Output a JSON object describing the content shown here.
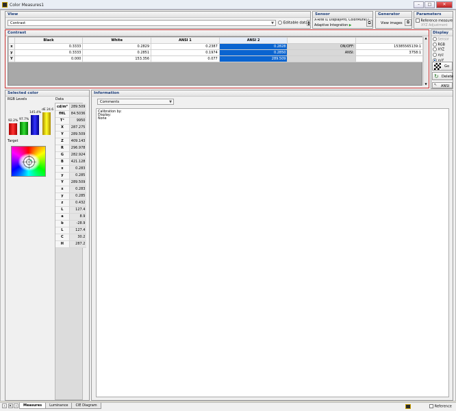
{
  "window": {
    "title": "Color Measures1",
    "min": "–",
    "max": "□",
    "close": "✕"
  },
  "view": {
    "title": "View",
    "selected": "Contrast",
    "editable_label": "Editable data"
  },
  "sensor": {
    "title": "Sensor",
    "device": "X-Rite i1 DisplayPro, ColorMunki Display",
    "mode": "Adaptive Integration"
  },
  "generator": {
    "title": "Generator",
    "button": "View images"
  },
  "parameters": {
    "title": "Parameters",
    "reference": "Reference measure",
    "adjust": "XYZ Adjustment"
  },
  "contrast": {
    "title": "Contrast",
    "columns": [
      "Black",
      "White",
      "ANSI 1",
      "ANSI 2"
    ],
    "rows": [
      {
        "h": "x",
        "cells": [
          "0.3333",
          "0.2829",
          "0.2387",
          "0.2828"
        ],
        "lbl": "ON/OFF:",
        "lval": "15385565139:1"
      },
      {
        "h": "y",
        "cells": [
          "0.3333",
          "0.2851",
          "0.1974",
          "0.2850"
        ],
        "lbl": "ANSI:",
        "lval": "3758:1"
      },
      {
        "h": "Y",
        "cells": [
          "0.000",
          "153.356",
          "0.077",
          "289.509"
        ],
        "lbl": "",
        "lval": ""
      }
    ]
  },
  "display": {
    "title": "Display",
    "options": [
      {
        "label": "Sensor",
        "on": false,
        "disabled": true
      },
      {
        "label": "RGB",
        "on": false,
        "disabled": false
      },
      {
        "label": "XYZ",
        "on": false,
        "disabled": false
      },
      {
        "label": "xyz",
        "on": false,
        "disabled": false
      },
      {
        "label": "xyY",
        "on": true,
        "disabled": false
      }
    ],
    "go": "Go",
    "delete": "Delete",
    "ansi": "ANSI"
  },
  "selected": {
    "title": "Selected color",
    "rgb_title": "RGB Levels",
    "data_title": "Data",
    "bars": {
      "r": "92.2%",
      "g": "97.7%",
      "b": "145.4%",
      "de": "dE 24.6"
    },
    "target": "Target",
    "rows": [
      [
        "cd/m²",
        "289.509"
      ],
      [
        "fHL",
        "84.5036"
      ],
      [
        "T°",
        "9950"
      ],
      [
        "X",
        "287.275"
      ],
      [
        "Y",
        "289.509"
      ],
      [
        "Z",
        "409.143"
      ],
      [
        "R",
        "296.978"
      ],
      [
        "G",
        "282.924"
      ],
      [
        "B",
        "421.128"
      ],
      [
        "x",
        "0.283"
      ],
      [
        "y",
        "0.285"
      ],
      [
        "Y",
        "289.509"
      ],
      [
        "x",
        "0.283"
      ],
      [
        "y",
        "0.285"
      ],
      [
        "z",
        "0.432"
      ],
      [
        "L",
        "127.4"
      ],
      [
        "a",
        "8.9"
      ],
      [
        "b",
        "-28.9"
      ],
      [
        "L",
        "127.4"
      ],
      [
        "C",
        "30.2"
      ],
      [
        "H",
        "287.2"
      ]
    ]
  },
  "information": {
    "title": "Information",
    "combo": "Comments",
    "text": [
      "Calibration by:",
      "Display:",
      "None"
    ]
  },
  "status": {
    "tabs": [
      "Measures",
      "Luminance",
      "CIE Diagram"
    ],
    "reference": "Reference"
  },
  "colors": {
    "accent": "#0a64d0",
    "panel_title": "#1a3c78",
    "highlight_border": "#c83030"
  }
}
